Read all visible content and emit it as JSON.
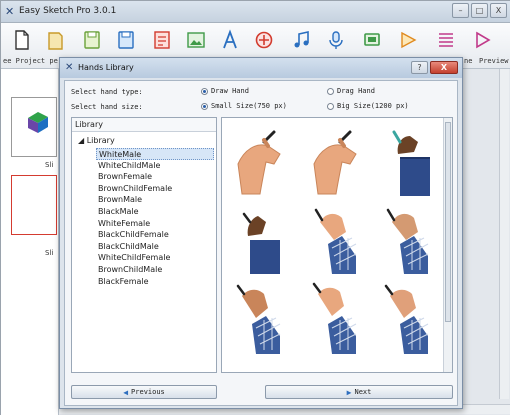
{
  "app": {
    "title": "Easy Sketch Pro 3.0.1",
    "window_buttons": [
      "–",
      "□",
      "X"
    ]
  },
  "toolbar": {
    "left_label": "ee Project pe",
    "right_label_1": "ne",
    "right_label_2": "Preview",
    "tools": [
      "new-document-icon",
      "open-folder-icon",
      "save-icon",
      "save-as-icon",
      "slide-icon",
      "image-icon",
      "text-icon",
      "shape-icon",
      "music-icon",
      "microphone-icon",
      "screen-icon",
      "hand-icon",
      "list-icon",
      "play-icon"
    ]
  },
  "slides": {
    "label_1": "Sli",
    "label_2": "Sli"
  },
  "dialog": {
    "title": "Hands Library",
    "help": "?",
    "close": "X",
    "hand_type_label": "Select hand type:",
    "hand_type_options": [
      "Draw Hand",
      "Drag Hand"
    ],
    "hand_type_selected": "Draw Hand",
    "hand_size_label": "Select hand size:",
    "hand_size_options": [
      "Small Size(750 px)",
      "Big Size(1200 px)"
    ],
    "hand_size_selected": "Small Size(750 px)",
    "tree_header": "Library",
    "tree_root": "Library",
    "tree_items": [
      "WhiteMale",
      "WhiteChildMale",
      "BrownFemale",
      "BrownChildFemale",
      "BrownMale",
      "BlackMale",
      "WhiteFemale",
      "BlackChildFemale",
      "BlackChildMale",
      "WhiteChildFemale",
      "BrownChildMale",
      "BlackFemale"
    ],
    "tree_selected": "WhiteMale",
    "previous_label": "Previous",
    "next_label": "Next"
  },
  "colors": {
    "skin_light": "#e8a77e",
    "skin_tan": "#c9855a",
    "skin_dark": "#6b4226",
    "shirt_blue": "#2e4b8a",
    "plaid_blue": "#3b5d9e",
    "accent": "#2f6fbf"
  }
}
